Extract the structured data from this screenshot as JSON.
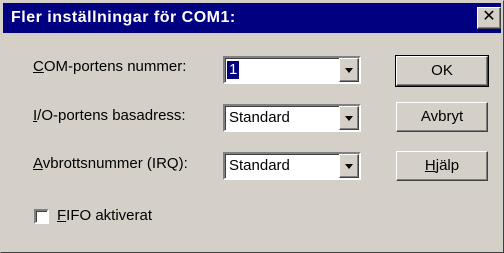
{
  "window": {
    "title": "Fler inställningar för COM1:",
    "close_glyph": "✕",
    "colors": {
      "titlebar": "#000080",
      "face": "#d4d0c8",
      "highlight": "#000080"
    }
  },
  "fields": [
    {
      "label_underlined": "C",
      "label_rest": "OM-portens nummer:",
      "value": "1",
      "selected": true
    },
    {
      "label_underlined": "I",
      "label_rest": "/O-portens basadress:",
      "value": "Standard",
      "selected": false
    },
    {
      "label_underlined": "A",
      "label_rest": "vbrottsnummer (IRQ):",
      "value": "Standard",
      "selected": false
    }
  ],
  "buttons": {
    "ok": "OK",
    "cancel": "Avbryt",
    "help_underlined": "H",
    "help_rest": "jälp"
  },
  "fifo": {
    "label_underlined": "F",
    "label_rest": "IFO aktiverat",
    "checked": false
  }
}
